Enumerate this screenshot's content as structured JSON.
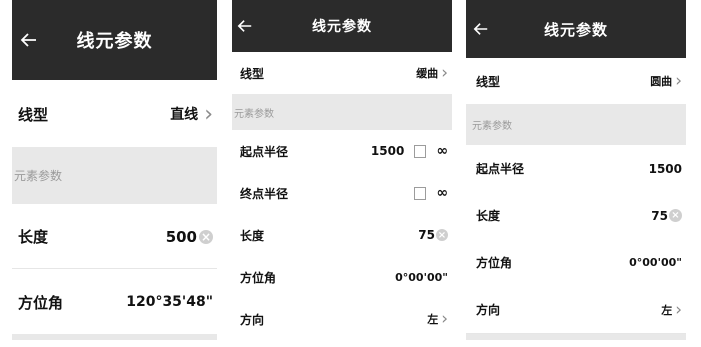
{
  "screens": [
    {
      "title": "线元参数",
      "rows": [
        {
          "label": "线型",
          "value": "直线",
          "chevron": "›"
        },
        {
          "section": "元素参数"
        },
        {
          "label": "长度",
          "value": "500",
          "clear": "×"
        },
        {
          "label": "方位角",
          "value": "120°35'48\""
        }
      ]
    },
    {
      "title": "线元参数",
      "rows": [
        {
          "label": "线型",
          "value": "缓曲",
          "chevron": "›"
        },
        {
          "section": "元素参数"
        },
        {
          "label": "起点半径",
          "value": "1500",
          "infinity": "∞"
        },
        {
          "label": "终点半径",
          "value": "",
          "infinity": "∞"
        },
        {
          "label": "长度",
          "value": "75",
          "clear": "×"
        },
        {
          "label": "方位角",
          "value": "0°00'00\""
        },
        {
          "label": "方向",
          "value": "左",
          "chevron": "›"
        }
      ]
    },
    {
      "title": "线元参数",
      "rows": [
        {
          "label": "线型",
          "value": "圆曲",
          "chevron": "›"
        },
        {
          "section": "元素参数"
        },
        {
          "label": "起点半径",
          "value": "1500"
        },
        {
          "label": "长度",
          "value": "75",
          "clear": "×"
        },
        {
          "label": "方位角",
          "value": "0°00'00\""
        },
        {
          "label": "方向",
          "value": "左",
          "chevron": "›"
        }
      ]
    }
  ],
  "icons": {
    "back": "arrow-left-icon",
    "clear": "clear-circle-icon",
    "chevron": "chevron-right-icon",
    "checkbox": "checkbox-icon"
  },
  "colors": {
    "header": "#2b2b2b",
    "section": "#e8e8e8",
    "section_text": "#9a9a9a",
    "clear": "#cfcfcf"
  }
}
